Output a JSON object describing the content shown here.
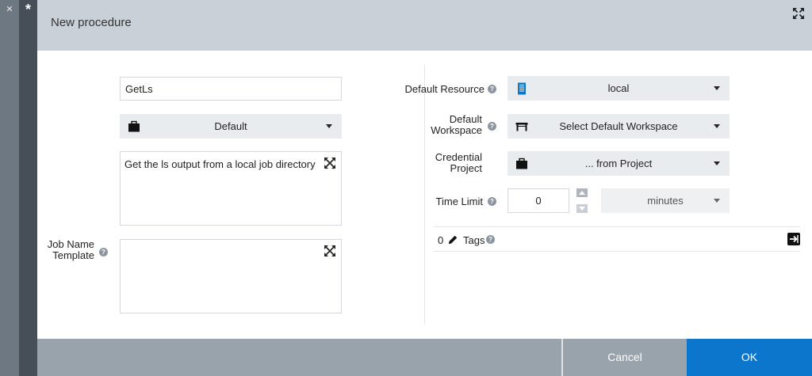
{
  "window": {
    "close_glyph": "×",
    "modified_glyph": "*",
    "title": "New procedure"
  },
  "form": {
    "name_value": "GetLs",
    "project_select": "Default",
    "description": "Get the ls output from a local job directory",
    "job_name_template_label": "Job Name Template",
    "job_name_template_value": "",
    "default_resource_label": "Default Resource",
    "default_resource_value": "local",
    "default_workspace_label": "Default Workspace",
    "default_workspace_value": "Select Default Workspace",
    "credential_project_label": "Credential Project",
    "credential_project_value": "... from Project",
    "time_limit_label": "Time Limit",
    "time_limit_value": "0",
    "time_limit_unit": "minutes",
    "tags_count": "0",
    "tags_label": "Tags",
    "help_glyph": "?"
  },
  "footer": {
    "cancel_label": "Cancel",
    "ok_label": "OK"
  },
  "colors": {
    "accent": "#0c76cc",
    "header_bg": "#c9d0d7",
    "footer_bg": "#98a3ab",
    "select_bg": "#e9ecef"
  }
}
